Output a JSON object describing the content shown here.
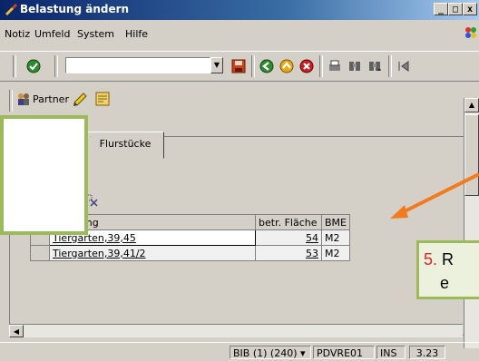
{
  "window": {
    "title": "Belastung ändern",
    "controls": [
      "_",
      "□",
      "x"
    ]
  },
  "menu": {
    "items": [
      "Notiz",
      "Umfeld",
      "System",
      "Hilfe"
    ]
  },
  "toolbar": {
    "command_value": "",
    "icons": [
      "check-icon",
      "save-icon",
      "back-icon",
      "exit-icon",
      "cancel-icon",
      "print-icon",
      "find-icon",
      "find-next-icon",
      "first-page-icon"
    ]
  },
  "app_toolbar": {
    "partner_label": "Partner"
  },
  "tabs": {
    "active_label": "Flurstücke"
  },
  "table": {
    "headers": [
      "eichnung",
      "betr. Fläche",
      "BME"
    ],
    "rows": [
      {
        "name": "Tiergarten,39,45",
        "area": "54",
        "unit": "M2"
      },
      {
        "name": "Tiergarten,39,41/2",
        "area": "53",
        "unit": "M2"
      }
    ]
  },
  "statusbar": {
    "system": "BIB (1) (240)",
    "server": "PDVRE01",
    "mode": "INS",
    "time": "3.23"
  },
  "annotation": {
    "step_number": "5.",
    "step_text_line1": "R",
    "step_text_line2": "e",
    "colors": {
      "number": "#e3252b",
      "border": "#9bbb59",
      "arrow": "#f07c1f"
    }
  }
}
